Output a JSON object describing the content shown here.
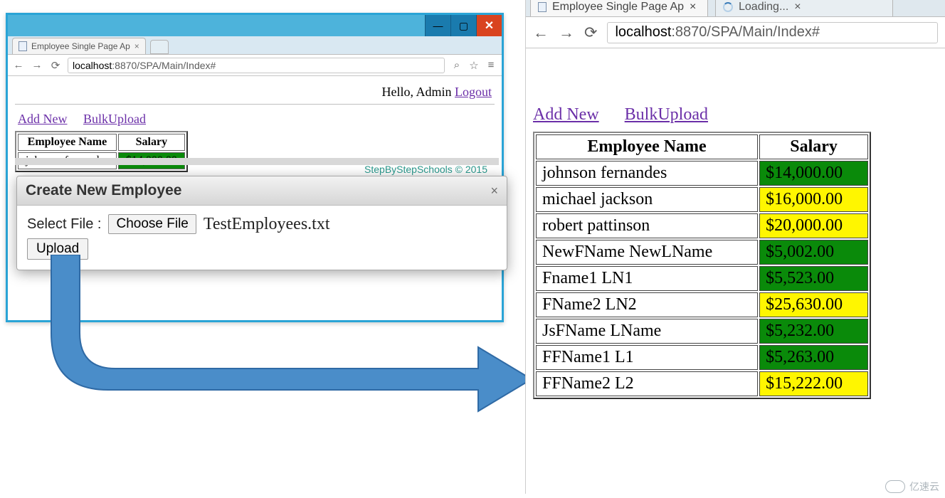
{
  "leftWindow": {
    "tab": {
      "title": "Employee Single Page Ap",
      "closeGlyph": "×"
    },
    "url": {
      "host": "localhost",
      "rest": ":8870/SPA/Main/Index#"
    },
    "greeting": "Hello, Admin ",
    "logout": "Logout",
    "links": {
      "addNew": "Add New",
      "bulkUpload": "BulkUpload"
    },
    "table": {
      "headers": {
        "name": "Employee Name",
        "salary": "Salary"
      },
      "rows": [
        {
          "name": "johnson fernandes",
          "salary": "$14,000.00",
          "cls": "sal-green"
        }
      ]
    },
    "dialog": {
      "title": "Create New Employee",
      "closeGlyph": "×",
      "selectLabel": "Select File :",
      "chooseBtn": "Choose File",
      "filename": "TestEmployees.txt",
      "uploadBtn": "Upload"
    },
    "footer": "StepByStepSchools © 2015",
    "winControls": {
      "min": "—",
      "max": "▢",
      "close": "✕"
    },
    "nav": {
      "back": "←",
      "fwd": "→",
      "reload": "⟳",
      "menu": "≡",
      "star": "☆",
      "mag": "⌕"
    }
  },
  "rightWindow": {
    "tab": {
      "title": "Employee Single Page Ap",
      "closeGlyph": "×"
    },
    "loadingTab": {
      "title": "Loading...",
      "closeGlyph": "×"
    },
    "url": {
      "host": "localhost",
      "rest": ":8870/SPA/Main/Index#"
    },
    "links": {
      "addNew": "Add New",
      "bulkUpload": "BulkUpload"
    },
    "table": {
      "headers": {
        "name": "Employee Name",
        "salary": "Salary"
      },
      "rows": [
        {
          "name": "johnson fernandes",
          "salary": "$14,000.00",
          "cls": "sal-green"
        },
        {
          "name": "michael jackson",
          "salary": "$16,000.00",
          "cls": "sal-yellow"
        },
        {
          "name": "robert pattinson",
          "salary": "$20,000.00",
          "cls": "sal-yellow"
        },
        {
          "name": "NewFName NewLName",
          "salary": "$5,002.00",
          "cls": "sal-green"
        },
        {
          "name": "Fname1 LN1",
          "salary": "$5,523.00",
          "cls": "sal-green"
        },
        {
          "name": "FName2 LN2",
          "salary": "$25,630.00",
          "cls": "sal-yellow"
        },
        {
          "name": "JsFName LName",
          "salary": "$5,232.00",
          "cls": "sal-green"
        },
        {
          "name": "FFName1 L1",
          "salary": "$5,263.00",
          "cls": "sal-green"
        },
        {
          "name": "FFName2 L2",
          "salary": "$15,222.00",
          "cls": "sal-yellow"
        }
      ]
    },
    "nav": {
      "back": "←",
      "fwd": "→",
      "reload": "⟳"
    }
  },
  "watermark": "亿速云"
}
